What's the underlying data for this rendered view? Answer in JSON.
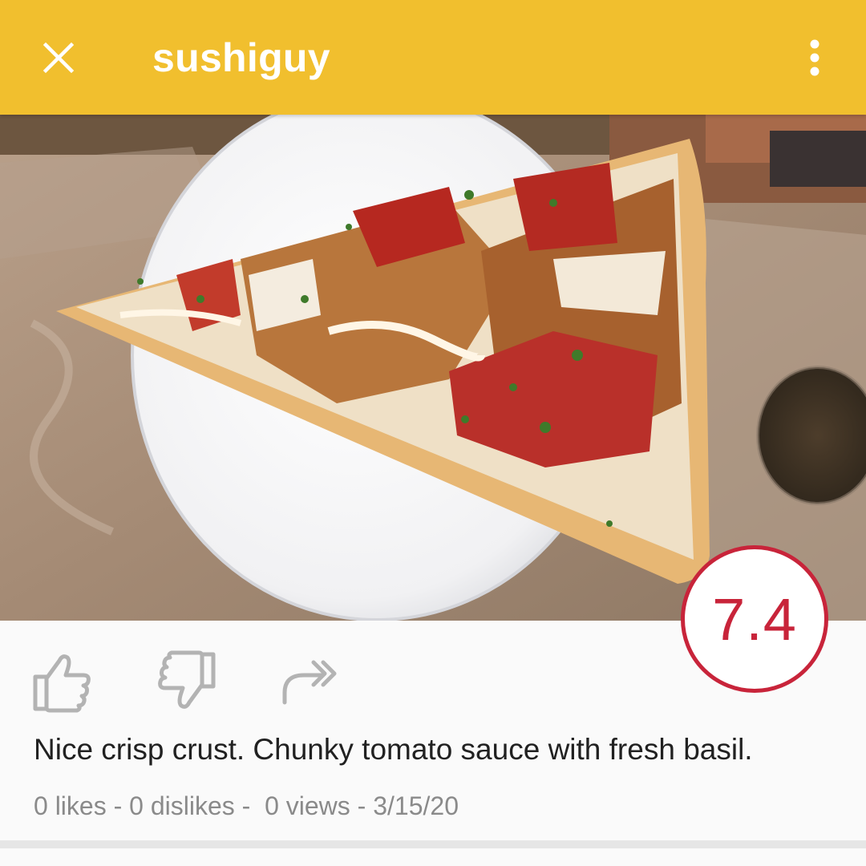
{
  "header": {
    "username": "sushiguy",
    "close_icon": "close-icon",
    "menu_icon": "more-vert-icon",
    "background_color": "#f1bf2e"
  },
  "post": {
    "photo_alt": "Slice of pizza on a white paper plate",
    "score": "7.4",
    "score_color": "#c8243a",
    "actions": {
      "like_icon": "thumbs-up-icon",
      "dislike_icon": "thumbs-down-icon",
      "share_icon": "share-icon"
    },
    "comment": "Nice crisp crust. Chunky tomato sauce with fresh basil.",
    "stats": "0 likes - 0 dislikes -  0 views - 3/15/20"
  }
}
